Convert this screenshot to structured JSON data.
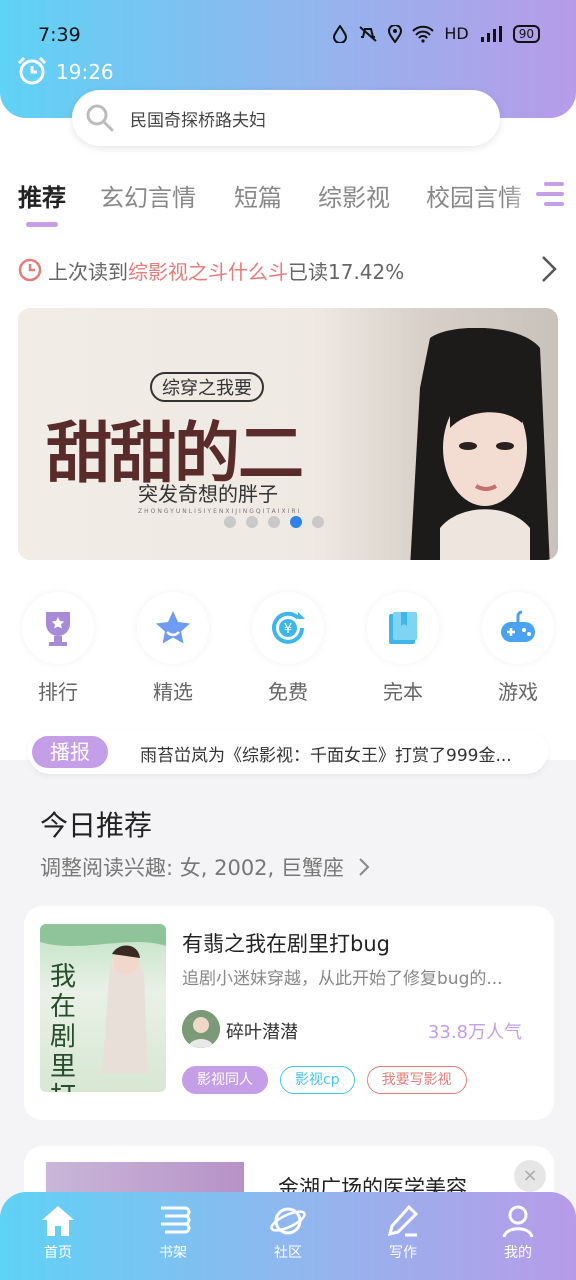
{
  "status_bar": {
    "time": "7:39",
    "network": "HD",
    "battery": "90"
  },
  "alarm": {
    "time": "19:26"
  },
  "search": {
    "placeholder": "民国奇探桥路夫妇"
  },
  "tabs": [
    {
      "label": "推荐",
      "active": true
    },
    {
      "label": "玄幻言情",
      "active": false
    },
    {
      "label": "短篇",
      "active": false
    },
    {
      "label": "综影视",
      "active": false
    },
    {
      "label": "校园言情",
      "active": false
    }
  ],
  "last_read": {
    "prefix": "上次读到",
    "book": "综影视之斗什么斗",
    "suffix": "已读17.42%"
  },
  "banner": {
    "tag": "综穿之我要",
    "title": "甜甜的二",
    "author": "突发奇想的胖子",
    "pinyin": "ZHONGYUNLISIYENXIJINGQITAIXIRI",
    "slides_total": 5,
    "slide_active_index": 3
  },
  "categories": [
    {
      "label": "排行",
      "icon": "trophy-icon",
      "color": "#a78bd6"
    },
    {
      "label": "精选",
      "icon": "star-icon",
      "color": "#6f9cf2"
    },
    {
      "label": "免费",
      "icon": "yuan-refresh-icon",
      "color": "#3db7ea"
    },
    {
      "label": "完本",
      "icon": "book-icon",
      "color": "#3db7ea"
    },
    {
      "label": "游戏",
      "icon": "gamepad-icon",
      "color": "#4aa3f0"
    }
  ],
  "broadcast": {
    "badge": "播报",
    "message": "雨苔峃岚为《综影视：千面女王》打赏了999金..."
  },
  "today": {
    "title": "今日推荐",
    "subtitle": "调整阅读兴趣: 女, 2002, 巨蟹座"
  },
  "book_card": {
    "cover_text": "我在剧里打bug",
    "title": "有翡之我在剧里打bug",
    "desc": "追剧小迷妹穿越，从此开始了修复bug的...",
    "author": "碎叶潜潜",
    "popularity": "33.8万人气",
    "tags": [
      "影视同人",
      "影视cp",
      "我要写影视"
    ]
  },
  "book_card2": {
    "title": "金湖广场的医学美容",
    "close": "×"
  },
  "bottom_nav": [
    {
      "label": "首页",
      "icon": "home-icon"
    },
    {
      "label": "书架",
      "icon": "bookshelf-icon"
    },
    {
      "label": "社区",
      "icon": "planet-icon"
    },
    {
      "label": "写作",
      "icon": "pen-icon"
    },
    {
      "label": "我的",
      "icon": "user-icon"
    }
  ],
  "colors": {
    "accent_purple": "#c59ee8",
    "accent_blue": "#45c4ea",
    "accent_red": "#e57d7a"
  }
}
